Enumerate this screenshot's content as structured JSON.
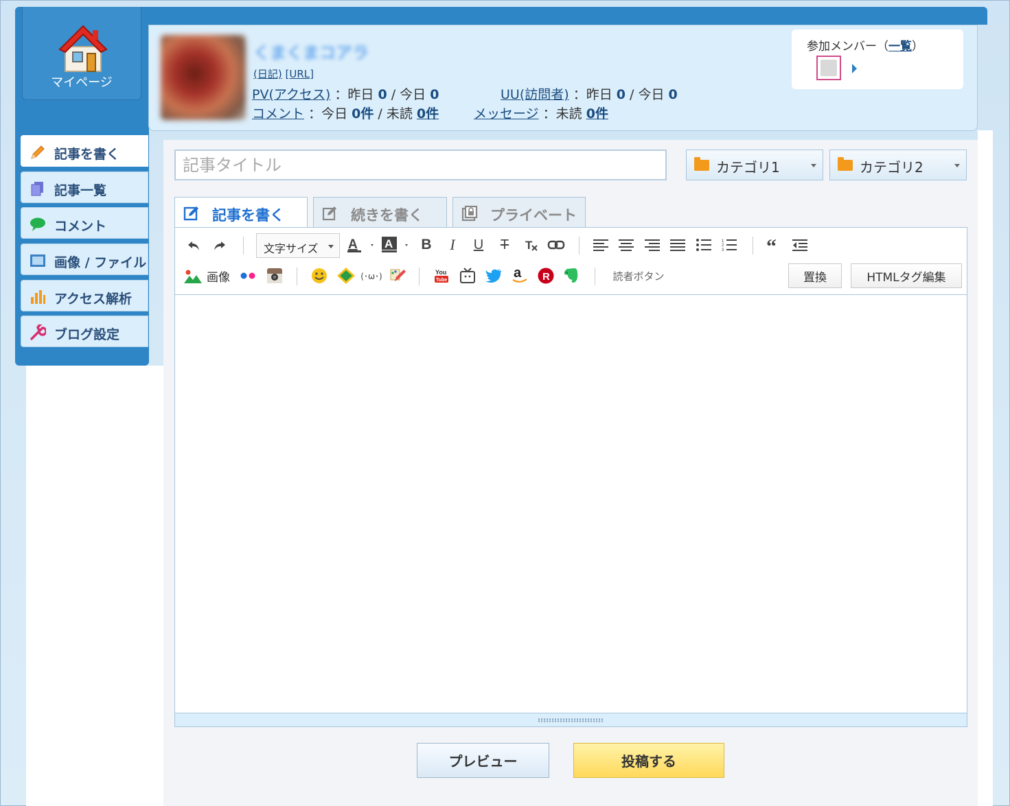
{
  "colors": {
    "header_blue": "#2f86c6",
    "panel_blue": "#dbeefb",
    "link": "#1a4c80",
    "accent_blue": "#1f6fd1",
    "post_yellow": "#ffd95b",
    "member_border": "#d04a8a",
    "folder_orange": "#f39a1c"
  },
  "mypage": {
    "label": "マイページ",
    "icon": "house-icon"
  },
  "blog": {
    "name": "くまくまコアラ",
    "diary_link": "(日記)",
    "url_link": "[URL]"
  },
  "stats": {
    "pv_link": "PV(アクセス)",
    "pv_text": "：昨日",
    "pv_yesterday": "0",
    "pv_today_label": "/ 今日",
    "pv_today": "0",
    "uu_link": "UU(訪問者)",
    "uu_text": "：昨日",
    "uu_yesterday": "0",
    "uu_today_label": "/ 今日",
    "uu_today": "0",
    "comment_link": "コメント",
    "comment_text": "：今日",
    "comment_today": "0件",
    "comment_unread_label": "/ 未読",
    "comment_unread": "0件",
    "message_link": "メッセージ",
    "message_text": "：未読",
    "message_unread": "0件"
  },
  "members": {
    "title_prefix": "参加メンバー（",
    "list_link": "一覧",
    "title_suffix": "）"
  },
  "sidebar": {
    "items": [
      {
        "label": "記事を書く",
        "icon": "pencil-icon"
      },
      {
        "label": "記事一覧",
        "icon": "documents-icon"
      },
      {
        "label": "コメント",
        "icon": "speech-bubble-icon"
      },
      {
        "label": "画像 / ファイル",
        "icon": "image-file-icon"
      },
      {
        "label": "アクセス解析",
        "icon": "bar-chart-icon"
      },
      {
        "label": "ブログ設定",
        "icon": "wrench-icon"
      }
    ]
  },
  "editor": {
    "title_placeholder": "記事タイトル",
    "category1": "カテゴリ1",
    "category2": "カテゴリ2",
    "tabs": [
      {
        "label": "記事を書く",
        "icon": "edit-icon"
      },
      {
        "label": "続きを書く",
        "icon": "continue-icon"
      },
      {
        "label": "プライベート",
        "icon": "private-icon"
      }
    ],
    "font_size_label": "文字サイズ",
    "image_label": "画像",
    "reader_button_label": "読者ボタン",
    "replace_button": "置換",
    "html_edit_button": "HTMLタグ編集"
  },
  "actions": {
    "preview": "プレビュー",
    "post": "投稿する"
  }
}
